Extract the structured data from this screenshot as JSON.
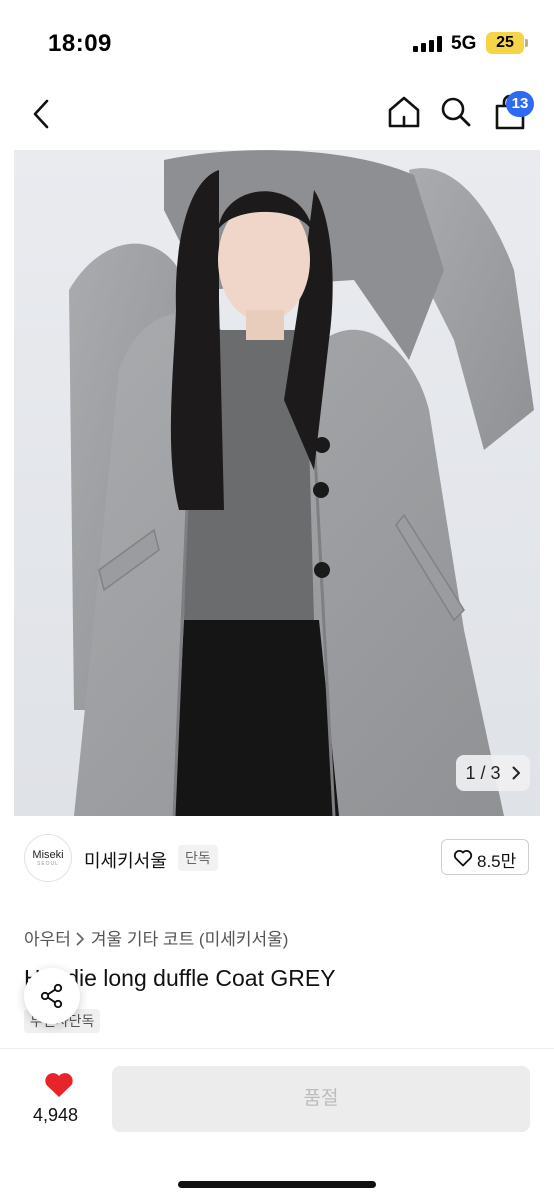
{
  "status_bar": {
    "time": "18:09",
    "network": "5G",
    "battery": "25"
  },
  "nav": {
    "cart_count": "13",
    "icons": [
      "chevron-left-icon",
      "home-icon",
      "search-icon",
      "shopping-bag-icon"
    ]
  },
  "gallery": {
    "indicator": "1 / 3"
  },
  "seller": {
    "logo_text": "Miseki",
    "logo_subtext": "SEOUL",
    "name": "미세키서울",
    "tag": "단독",
    "likes": "8.5만"
  },
  "product": {
    "breadcrumb": [
      "아우터",
      "겨울 기타 코트 (미세키서울)"
    ],
    "title": "Hoodie long duffle Coat GREY",
    "shipping_tag": "무신사단독"
  },
  "bottom_bar": {
    "wish_count": "4,948",
    "buy_button_label": "품절"
  },
  "colors": {
    "accent_blue": "#2f6bf2",
    "heart_red": "#e8232a",
    "battery_yellow": "#f5d547",
    "soldout_bg": "#ececec"
  }
}
